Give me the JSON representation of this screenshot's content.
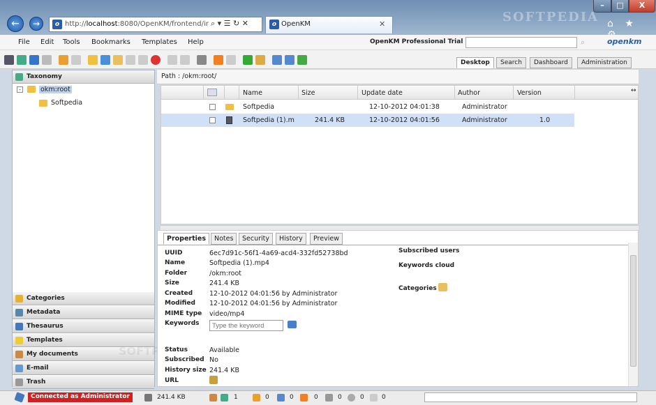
{
  "browser": {
    "address_prefix": "http://",
    "address_host": "localhost",
    "address_rest": ":8080/OpenKM/frontend/ir",
    "address_icons": "⌕ ▾ ☰ ↻ ✕",
    "tab_title": "OpenKM",
    "tab_close": "✕",
    "watermark": "SOFTPEDIA",
    "icons": "⌂ ★ ⚙",
    "min": "–",
    "max": "□",
    "close": "X"
  },
  "menu": {
    "items": [
      "File",
      "Edit",
      "Tools",
      "Bookmarks",
      "Templates",
      "Help"
    ]
  },
  "header": {
    "trial": "OpenKM Professional Trial",
    "logo": "openkm"
  },
  "tabs": [
    "Desktop",
    "Search",
    "Dashboard",
    "Administration"
  ],
  "left": {
    "taxonomy": "Taxonomy",
    "root": "okm:root",
    "child": "Softpedia",
    "panels": [
      "Categories",
      "Metadata",
      "Thesaurus",
      "Templates",
      "My documents",
      "E-mail",
      "Trash"
    ]
  },
  "path": "Path : /okm:root/",
  "grid": {
    "columns": [
      "Name",
      "Size",
      "Update date",
      "Author",
      "Version"
    ],
    "expand": "↔",
    "rows": [
      {
        "name": "Softpedia",
        "size": "",
        "date": "12-10-2012 04:01:38",
        "author": "Administrator",
        "version": ""
      },
      {
        "name": "Softpedia (1).m",
        "size": "241.4 KB",
        "date": "12-10-2012 04:01:56",
        "author": "Administrator",
        "version": "1.0"
      }
    ]
  },
  "props": {
    "tabs": [
      "Properties",
      "Notes",
      "Security",
      "History",
      "Preview"
    ],
    "uuid_l": "UUID",
    "uuid": "6ec7d91c-56f1-4a69-acd4-332fd52738bd",
    "name_l": "Name",
    "name": "Softpedia (1).mp4",
    "folder_l": "Folder",
    "folder": "/okm:root",
    "size_l": "Size",
    "size": "241.4 KB",
    "created_l": "Created",
    "created": "12-10-2012 04:01:56 by Administrator",
    "modified_l": "Modified",
    "modified": "12-10-2012 04:01:56 by Administrator",
    "mime_l": "MIME type",
    "mime": "video/mp4",
    "keywords_l": "Keywords",
    "keywords_placeholder": "Type the keyword",
    "status_l": "Status",
    "status": "Available",
    "subscribed_l": "Subscribed",
    "subscribed": "No",
    "history_l": "History size",
    "history": "241.4 KB",
    "url_l": "URL",
    "subscribed_users": "Subscribed users",
    "keywords_cloud": "Keywords cloud",
    "categories": "Categories"
  },
  "status": {
    "connected": "Connected as Administrator",
    "size": "241.4 KB",
    "c1": "1",
    "c2": "0",
    "c3": "0",
    "c4": "0",
    "c5": "0",
    "c6": "0",
    "c7": "0"
  }
}
